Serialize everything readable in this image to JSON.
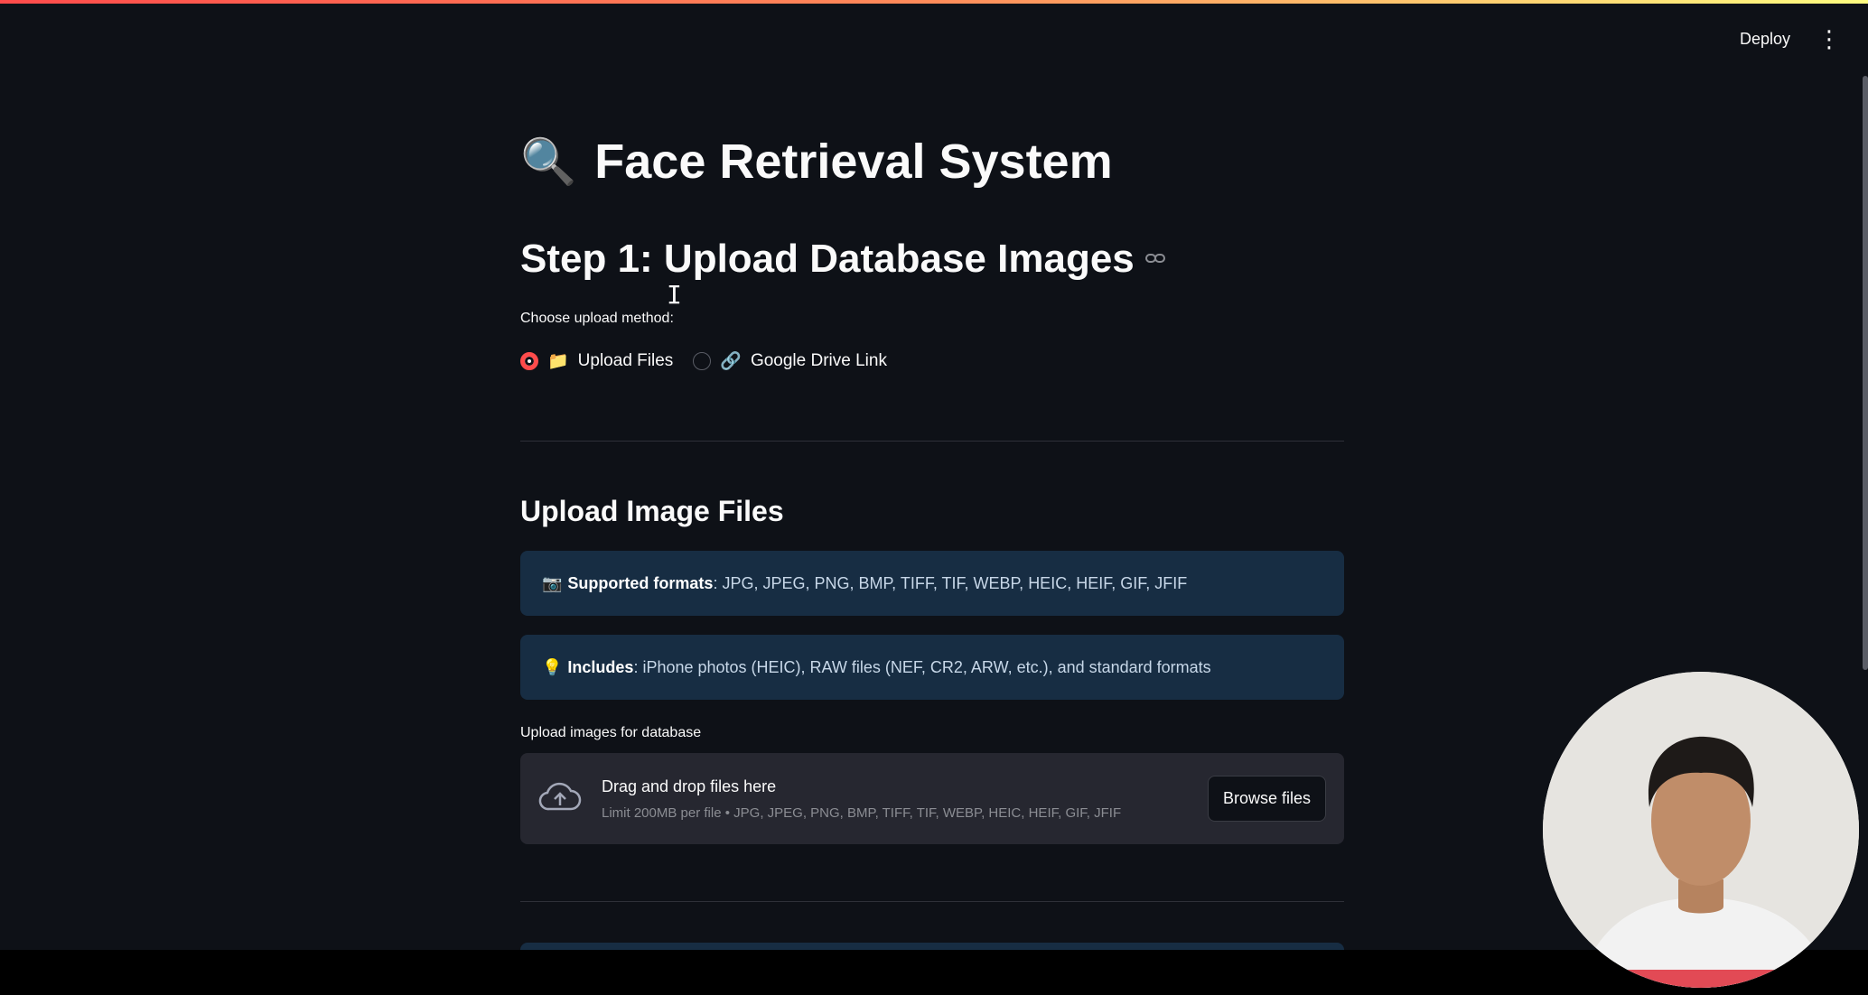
{
  "header": {
    "deploy_label": "Deploy",
    "menu_icon": "kebab-menu-icon"
  },
  "page": {
    "title_icon": "🔍",
    "title": "Face Retrieval System",
    "step1_heading": "Step 1: Upload Database Images",
    "upload_method_label": "Choose upload method:",
    "upload_methods": [
      {
        "icon": "📁",
        "label": "Upload Files",
        "selected": true
      },
      {
        "icon": "🔗",
        "label": "Google Drive Link",
        "selected": false
      }
    ],
    "section_heading": "Upload Image Files",
    "info_boxes": [
      {
        "icon": "📷",
        "bold": "Supported formats",
        "text": ": JPG, JPEG, PNG, BMP, TIFF, TIF, WEBP, HEIC, HEIF, GIF, JFIF"
      },
      {
        "icon": "💡",
        "bold": "Includes",
        "text": ": iPhone photos (HEIC), RAW files (NEF, CR2, ARW, etc.), and standard formats"
      }
    ],
    "uploader": {
      "label": "Upload images for database",
      "drop_title": "Drag and drop files here",
      "limit_text": "Limit 200MB per file • JPG, JPEG, PNG, BMP, TIFF, TIF, WEBP, HEIC, HEIF, GIF, JFIF",
      "browse_label": "Browse files"
    }
  },
  "colors": {
    "background": "#0e1117",
    "accent": "#ff4b4b",
    "info_bg": "#172d43",
    "dropzone_bg": "#262730"
  }
}
